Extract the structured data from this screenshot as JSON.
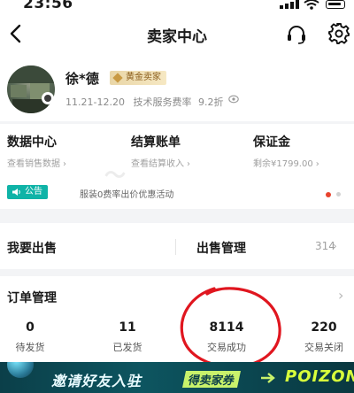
{
  "status_bar": {
    "time": "23:56"
  },
  "header": {
    "title": "卖家中心"
  },
  "seller": {
    "name": "徐*德",
    "tier_badge": "黄金卖家",
    "period": "11.21-12.20",
    "fee_label": "技术服务费率",
    "fee_value": "9.2折"
  },
  "stats": [
    {
      "title": "数据中心",
      "subtitle": "查看销售数据"
    },
    {
      "title": "结算账单",
      "subtitle": "查看结算收入"
    },
    {
      "title": "保证金",
      "subtitle": "剩余¥1799.00"
    }
  ],
  "notice": {
    "tag": "公告",
    "text": "服装0费率出价优惠活动"
  },
  "sell": {
    "left_label": "我要出售",
    "mgmt_label": "出售管理",
    "mgmt_count": "314"
  },
  "orders": {
    "title": "订单管理",
    "items": [
      {
        "value": "0",
        "label": "待发货"
      },
      {
        "value": "11",
        "label": "已发货"
      },
      {
        "value": "8114",
        "label": "交易成功"
      },
      {
        "value": "220",
        "label": "交易关闭"
      }
    ]
  },
  "banner": {
    "text_invite": "邀请好友入驻",
    "text_earn": "得卖家券",
    "brand": "POIZON"
  },
  "colors": {
    "accent_teal": "#0fb3a7",
    "gold_badge": "#e9d6a7",
    "annotation_red": "#e0161f"
  },
  "icons": [
    "back-arrow-icon",
    "headset-icon",
    "gear-icon",
    "eye-icon",
    "speaker-icon",
    "chevron-right-icon"
  ]
}
